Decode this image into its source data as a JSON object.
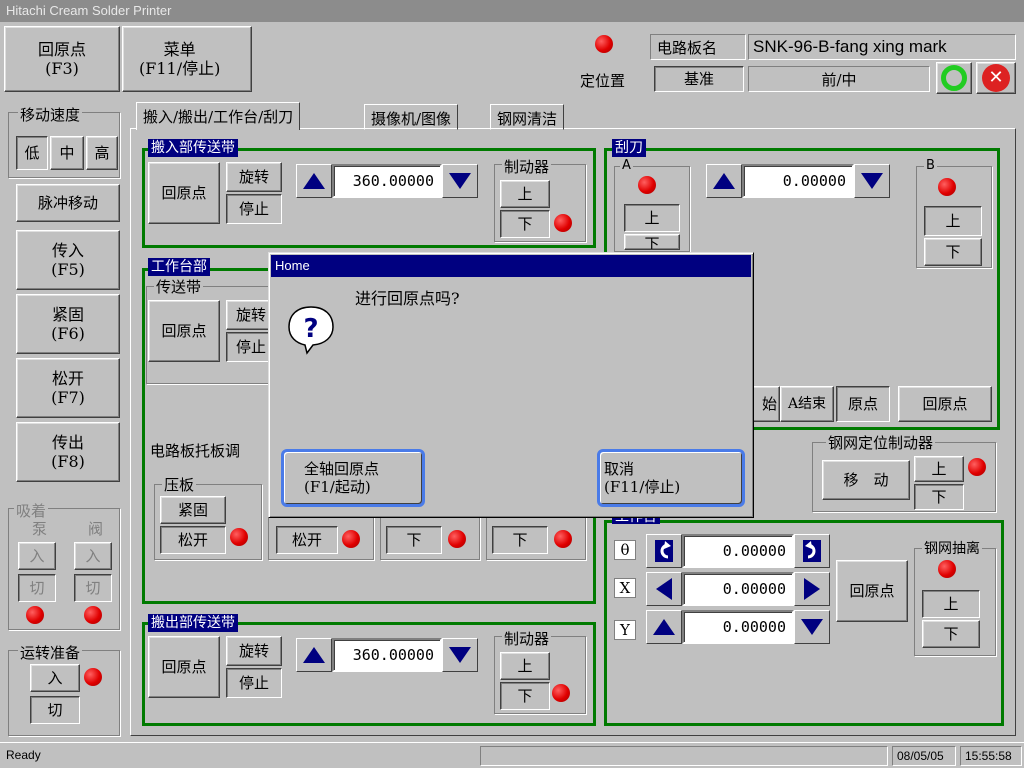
{
  "window": {
    "title": "Hitachi Cream Solder Printer"
  },
  "toolbar": {
    "home_btn": "回原点\n(F3)",
    "menu_btn": "菜单\n(F11/停止)",
    "position_label": "定位置",
    "board_name_label": "电路板名",
    "board_name_value": "SNK-96-B-fang xing mark",
    "reference_btn": "基准",
    "front_mid_value": "前/中"
  },
  "sidebar": {
    "speed_title": "移动速度",
    "speed_low": "低",
    "speed_mid": "中",
    "speed_high": "高",
    "pulse_btn": "脉冲移动",
    "load_btn": "传入\n(F5)",
    "clamp_btn": "紧固\n(F6)",
    "release_btn": "松开\n(F7)",
    "unload_btn": "传出\n(F8)",
    "suction_title": "吸着",
    "pump_label": "泵",
    "valve_label": "阀",
    "on_label": "入",
    "off_label": "切",
    "ready_title": "运转准备",
    "ready_on": "入",
    "ready_off": "切"
  },
  "tabs": [
    {
      "label": "搬入/搬出/工作台/刮刀"
    },
    {
      "label": "摄像机/图像"
    },
    {
      "label": "钢网清洁"
    }
  ],
  "load_conveyor": {
    "title": "搬入部传送带",
    "home": "回原点",
    "rotate": "旋转",
    "stop": "停止",
    "value": "360.00000",
    "brake_title": "制动器",
    "up": "上",
    "down": "下"
  },
  "table_section": {
    "title": "工作台部",
    "conveyor_title": "传送带",
    "home": "回原点",
    "rotate": "旋转",
    "stop": "停止",
    "pcb_tray_label": "电路板托板调",
    "press_title": "压板",
    "clamp": "紧固",
    "release": "松开",
    "release2": "松开",
    "down1": "下",
    "down2": "下"
  },
  "unload_conveyor": {
    "title": "搬出部传送带",
    "home": "回原点",
    "rotate": "旋转",
    "stop": "停止",
    "value": "360.00000",
    "brake_title": "制动器",
    "up": "上",
    "down": "下"
  },
  "squeegee": {
    "title": "刮刀",
    "a_label": "A",
    "b_label": "B",
    "a_up": "上",
    "a_down": "下",
    "b_up": "上",
    "b_down": "下",
    "value": "0.00000",
    "start_btn": "始",
    "a_end_btn": "A结束",
    "origin_btn": "原点",
    "home_btn": "回原点"
  },
  "stencil_brake": {
    "title": "钢网定位制动器",
    "move": "移　动",
    "up": "上",
    "down": "下"
  },
  "work_table": {
    "title": "工作台",
    "theta_label": "θ",
    "x_label": "X",
    "y_label": "Y",
    "theta_value": "0.00000",
    "x_value": "0.00000",
    "y_value": "0.00000",
    "home_btn": "回原点"
  },
  "stencil_drawer": {
    "title": "钢网抽离",
    "up": "上",
    "down": "下"
  },
  "dialog": {
    "title": "Home",
    "message": "进行回原点吗?",
    "all_axis_btn": "全轴回原点\n(F1/起动)",
    "cancel_btn": "取消\n(F11/停止)"
  },
  "statusbar": {
    "status": "Ready",
    "date": "08/05/05",
    "time": "15:55:58"
  },
  "colors": {
    "group_border": "#007a00",
    "title_bg": "#000080",
    "led_red": "#e00000",
    "ok_green": "#22cc22",
    "close_red": "#dd2222"
  }
}
